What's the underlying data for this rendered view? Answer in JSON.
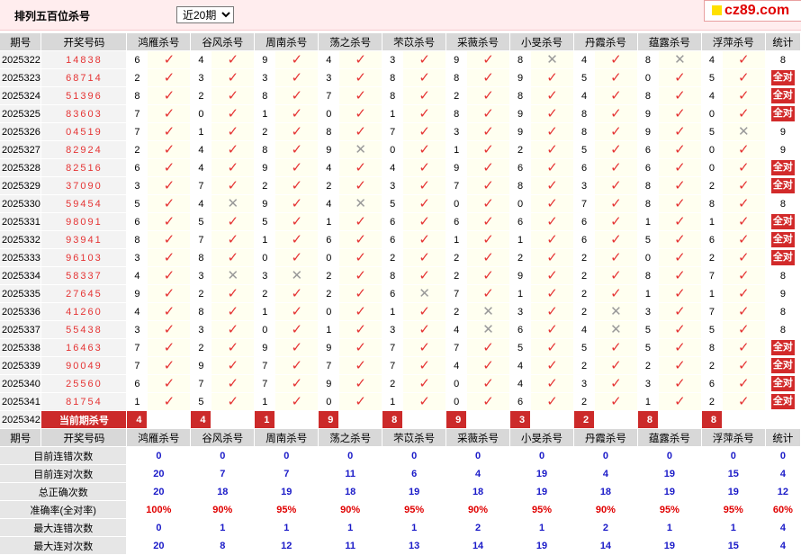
{
  "header": {
    "title": "排列五百位杀号",
    "period_select": {
      "selected": "近20期",
      "options": [
        "近20期"
      ]
    },
    "logo_text": "cz89.com"
  },
  "colors": {
    "mark_ok": "#E53333",
    "mark_no": "#999999",
    "badge": "#D22A2A",
    "stat_value": "#1A1AC8",
    "stat_percent": "#E00000",
    "header_bg": "#FFEDEE"
  },
  "table": {
    "columns": [
      "期号",
      "开奖号码",
      "鸿雁杀号",
      "谷风杀号",
      "周南杀号",
      "荡之杀号",
      "芣苡杀号",
      "采薇杀号",
      "小旻杀号",
      "丹霞杀号",
      "蕴露杀号",
      "浮萍杀号",
      "统计"
    ],
    "rows": [
      {
        "issue": "2025322",
        "draw": "14838",
        "picks": [
          6,
          4,
          9,
          4,
          3,
          9,
          8,
          4,
          8,
          4
        ],
        "hits": [
          1,
          1,
          1,
          1,
          1,
          1,
          0,
          1,
          0,
          1
        ],
        "total": "8",
        "full": false
      },
      {
        "issue": "2025323",
        "draw": "68714",
        "picks": [
          2,
          3,
          3,
          3,
          8,
          8,
          9,
          5,
          0,
          5
        ],
        "hits": [
          1,
          1,
          1,
          1,
          1,
          1,
          1,
          1,
          1,
          1
        ],
        "total": "全对",
        "full": true
      },
      {
        "issue": "2025324",
        "draw": "51396",
        "picks": [
          8,
          2,
          8,
          7,
          8,
          2,
          8,
          4,
          8,
          4
        ],
        "hits": [
          1,
          1,
          1,
          1,
          1,
          1,
          1,
          1,
          1,
          1
        ],
        "total": "全对",
        "full": true
      },
      {
        "issue": "2025325",
        "draw": "83603",
        "picks": [
          7,
          0,
          1,
          0,
          1,
          8,
          9,
          8,
          9,
          0
        ],
        "hits": [
          1,
          1,
          1,
          1,
          1,
          1,
          1,
          1,
          1,
          1
        ],
        "total": "全对",
        "full": true
      },
      {
        "issue": "2025326",
        "draw": "04519",
        "picks": [
          7,
          1,
          2,
          8,
          7,
          3,
          9,
          8,
          9,
          5
        ],
        "hits": [
          1,
          1,
          1,
          1,
          1,
          1,
          1,
          1,
          1,
          0
        ],
        "total": "9",
        "full": false
      },
      {
        "issue": "2025327",
        "draw": "82924",
        "picks": [
          2,
          4,
          8,
          9,
          0,
          1,
          2,
          5,
          6,
          0
        ],
        "hits": [
          1,
          1,
          1,
          0,
          1,
          1,
          1,
          1,
          1,
          1
        ],
        "total": "9",
        "full": false
      },
      {
        "issue": "2025328",
        "draw": "82516",
        "picks": [
          6,
          4,
          9,
          4,
          4,
          9,
          6,
          6,
          6,
          0
        ],
        "hits": [
          1,
          1,
          1,
          1,
          1,
          1,
          1,
          1,
          1,
          1
        ],
        "total": "全对",
        "full": true
      },
      {
        "issue": "2025329",
        "draw": "37090",
        "picks": [
          3,
          7,
          2,
          2,
          3,
          7,
          8,
          3,
          8,
          2
        ],
        "hits": [
          1,
          1,
          1,
          1,
          1,
          1,
          1,
          1,
          1,
          1
        ],
        "total": "全对",
        "full": true
      },
      {
        "issue": "2025330",
        "draw": "59454",
        "picks": [
          5,
          4,
          9,
          4,
          5,
          0,
          0,
          7,
          8,
          8
        ],
        "hits": [
          1,
          0,
          1,
          0,
          1,
          1,
          1,
          1,
          1,
          1
        ],
        "total": "8",
        "full": false
      },
      {
        "issue": "2025331",
        "draw": "98091",
        "picks": [
          6,
          5,
          5,
          1,
          6,
          6,
          6,
          6,
          1,
          1
        ],
        "hits": [
          1,
          1,
          1,
          1,
          1,
          1,
          1,
          1,
          1,
          1
        ],
        "total": "全对",
        "full": true
      },
      {
        "issue": "2025332",
        "draw": "93941",
        "picks": [
          8,
          7,
          1,
          6,
          6,
          1,
          1,
          6,
          5,
          6
        ],
        "hits": [
          1,
          1,
          1,
          1,
          1,
          1,
          1,
          1,
          1,
          1
        ],
        "total": "全对",
        "full": true
      },
      {
        "issue": "2025333",
        "draw": "96103",
        "picks": [
          3,
          8,
          0,
          0,
          2,
          2,
          2,
          2,
          0,
          2
        ],
        "hits": [
          1,
          1,
          1,
          1,
          1,
          1,
          1,
          1,
          1,
          1
        ],
        "total": "全对",
        "full": true
      },
      {
        "issue": "2025334",
        "draw": "58337",
        "picks": [
          4,
          3,
          3,
          2,
          8,
          2,
          9,
          2,
          8,
          7
        ],
        "hits": [
          1,
          0,
          0,
          1,
          1,
          1,
          1,
          1,
          1,
          1
        ],
        "total": "8",
        "full": false
      },
      {
        "issue": "2025335",
        "draw": "27645",
        "picks": [
          9,
          2,
          2,
          2,
          6,
          7,
          1,
          2,
          1,
          1
        ],
        "hits": [
          1,
          1,
          1,
          1,
          0,
          1,
          1,
          1,
          1,
          1
        ],
        "total": "9",
        "full": false
      },
      {
        "issue": "2025336",
        "draw": "41260",
        "picks": [
          4,
          8,
          1,
          0,
          1,
          2,
          3,
          2,
          3,
          7
        ],
        "hits": [
          1,
          1,
          1,
          1,
          1,
          0,
          1,
          0,
          1,
          1
        ],
        "total": "8",
        "full": false
      },
      {
        "issue": "2025337",
        "draw": "55438",
        "picks": [
          3,
          3,
          0,
          1,
          3,
          4,
          6,
          4,
          5,
          5
        ],
        "hits": [
          1,
          1,
          1,
          1,
          1,
          0,
          1,
          0,
          1,
          1
        ],
        "total": "8",
        "full": false
      },
      {
        "issue": "2025338",
        "draw": "16463",
        "picks": [
          7,
          2,
          9,
          9,
          7,
          7,
          5,
          5,
          5,
          8
        ],
        "hits": [
          1,
          1,
          1,
          1,
          1,
          1,
          1,
          1,
          1,
          1
        ],
        "total": "全对",
        "full": true
      },
      {
        "issue": "2025339",
        "draw": "90049",
        "picks": [
          7,
          9,
          7,
          7,
          7,
          4,
          4,
          2,
          2,
          2
        ],
        "hits": [
          1,
          1,
          1,
          1,
          1,
          1,
          1,
          1,
          1,
          1
        ],
        "total": "全对",
        "full": true
      },
      {
        "issue": "2025340",
        "draw": "25560",
        "picks": [
          6,
          7,
          7,
          9,
          2,
          0,
          4,
          3,
          3,
          6
        ],
        "hits": [
          1,
          1,
          1,
          1,
          1,
          1,
          1,
          1,
          1,
          1
        ],
        "total": "全对",
        "full": true
      },
      {
        "issue": "2025341",
        "draw": "81754",
        "picks": [
          1,
          5,
          1,
          0,
          1,
          0,
          6,
          2,
          1,
          2
        ],
        "hits": [
          1,
          1,
          1,
          1,
          1,
          1,
          1,
          1,
          1,
          1
        ],
        "total": "全对",
        "full": true
      }
    ],
    "current": {
      "issue": "2025342",
      "label": "当前期杀号",
      "kills": [
        "4",
        "4",
        "1",
        "9",
        "8",
        "9",
        "3",
        "2",
        "8",
        "8"
      ]
    },
    "stats": [
      {
        "label": "目前连错次数",
        "values": [
          "0",
          "0",
          "0",
          "0",
          "0",
          "0",
          "0",
          "0",
          "0",
          "0",
          "0"
        ]
      },
      {
        "label": "目前连对次数",
        "values": [
          "20",
          "7",
          "7",
          "11",
          "6",
          "4",
          "19",
          "4",
          "19",
          "15",
          "4"
        ]
      },
      {
        "label": "总正确次数",
        "values": [
          "20",
          "18",
          "19",
          "18",
          "19",
          "18",
          "19",
          "18",
          "19",
          "19",
          "12"
        ]
      },
      {
        "label": "准确率(全对率)",
        "values": [
          "100%",
          "90%",
          "95%",
          "90%",
          "95%",
          "90%",
          "95%",
          "90%",
          "95%",
          "95%",
          "60%"
        ]
      },
      {
        "label": "最大连错次数",
        "values": [
          "0",
          "1",
          "1",
          "1",
          "1",
          "2",
          "1",
          "2",
          "1",
          "1",
          "4"
        ]
      },
      {
        "label": "最大连对次数",
        "values": [
          "20",
          "8",
          "12",
          "11",
          "13",
          "14",
          "19",
          "14",
          "19",
          "15",
          "4"
        ]
      }
    ]
  }
}
